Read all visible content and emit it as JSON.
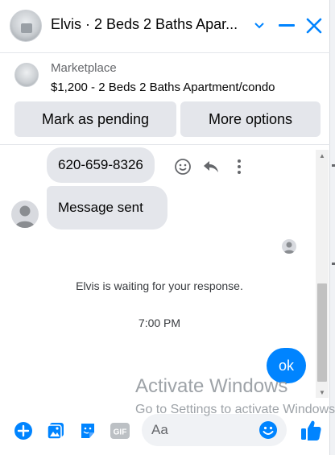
{
  "header": {
    "title": "Elvis · 2 Beds 2 Baths Apar...",
    "icons": [
      "chevron-down-icon",
      "minimize-icon",
      "close-icon"
    ]
  },
  "banner": {
    "label": "Marketplace",
    "listing": "$1,200 - 2 Beds 2 Baths Apartment/condo",
    "buttons": {
      "pending": "Mark as pending",
      "more": "More options"
    }
  },
  "messages": {
    "phone": "620-659-8326",
    "sent": "Message sent",
    "waiting": "Elvis is waiting for your response.",
    "time": "7:00 PM",
    "ok": "ok"
  },
  "composer": {
    "placeholder": "Aa",
    "icons": [
      "plus-icon",
      "photo-icon",
      "sticker-icon",
      "gif-icon",
      "emoji-icon",
      "thumbs-up-icon"
    ]
  },
  "watermark": {
    "title": "Activate Windows",
    "subtitle": "Go to Settings to activate Windows."
  },
  "colors": {
    "accent": "#0084ff",
    "bubble": "#e4e6eb"
  }
}
